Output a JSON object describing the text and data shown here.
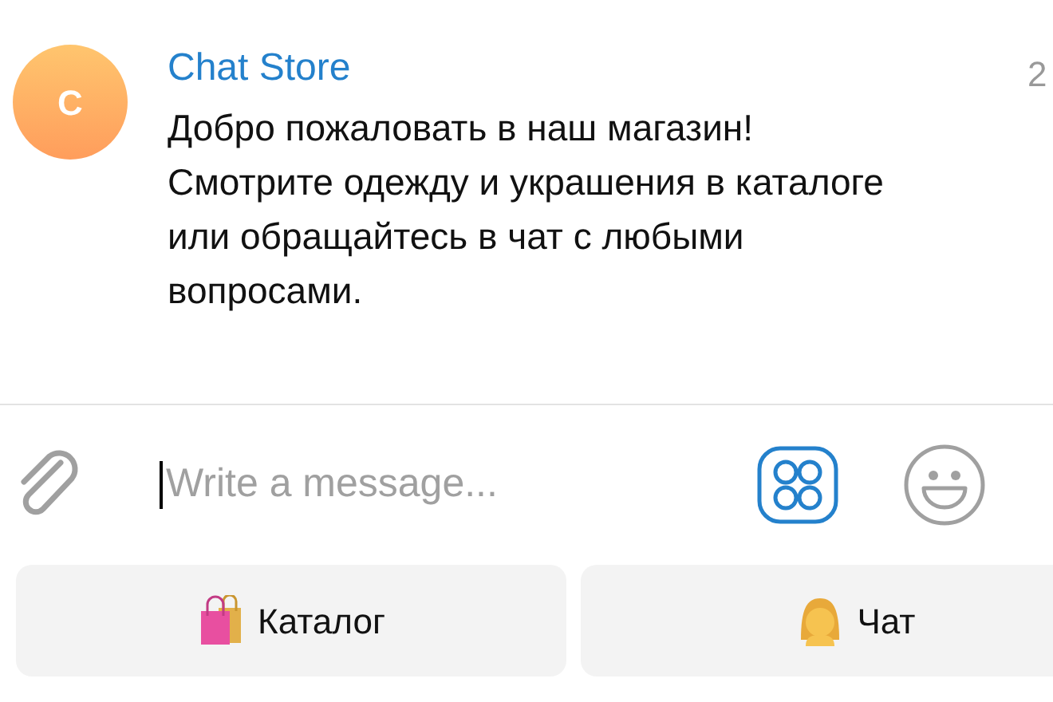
{
  "message": {
    "avatar_letter": "C",
    "sender": "Chat Store",
    "time": "2",
    "text": "Добро пожаловать в наш магазин! Смотрите одежду и украшения в каталоге или обращайтесь в чат с любыми вопросами."
  },
  "composer": {
    "placeholder": "Write a message..."
  },
  "keyboard": [
    {
      "kind": "bags",
      "label": "Каталог"
    },
    {
      "kind": "person",
      "label": "Чат"
    }
  ]
}
